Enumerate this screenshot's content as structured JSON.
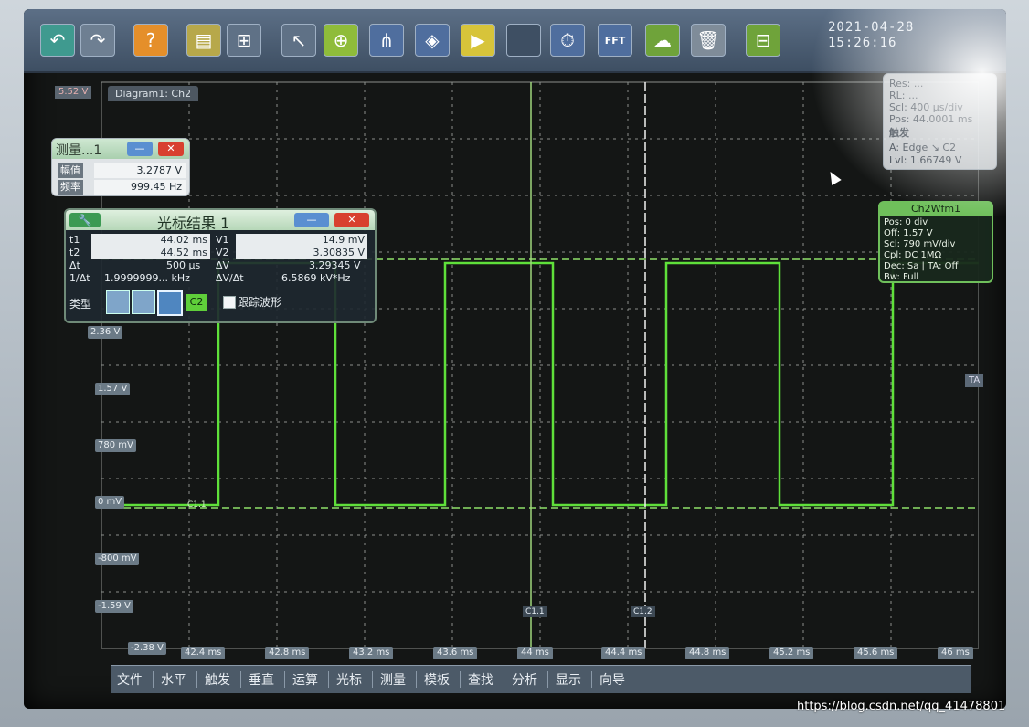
{
  "datetime": {
    "date": "2021-04-28",
    "time": "15:26:16"
  },
  "toolbar": {
    "buttons": [
      {
        "name": "undo-icon",
        "glyph": "↶",
        "bg": "#3f9a8f"
      },
      {
        "name": "redo-icon",
        "glyph": "↷",
        "bg": "#6e7f92"
      },
      {
        "name": "help-icon",
        "glyph": "?",
        "bg": "#e58f2a"
      },
      {
        "name": "folder-icon",
        "glyph": "▤",
        "bg": "#b7a84a"
      },
      {
        "name": "layout-icon",
        "glyph": "⊞",
        "bg": "#5f7186"
      },
      {
        "name": "pointer-icon",
        "glyph": "↖",
        "bg": "#5f7186"
      },
      {
        "name": "zoom-icon",
        "glyph": "⊕",
        "bg": "#8fbc3a"
      },
      {
        "name": "cursor-measure-icon",
        "glyph": "⋔",
        "bg": "#4f6e9e"
      },
      {
        "name": "mask-icon",
        "glyph": "◈",
        "bg": "#4f6e9e"
      },
      {
        "name": "marker-icon",
        "glyph": "▶",
        "bg": "#d7c43a"
      },
      {
        "name": "spacer-icon",
        "glyph": "",
        "bg": "#3e4f63"
      },
      {
        "name": "timer-icon",
        "glyph": "⏱",
        "bg": "#4f6e9e"
      },
      {
        "name": "fft-icon",
        "glyph": "FFT",
        "bg": "#4f6e9e"
      },
      {
        "name": "cloud-icon",
        "glyph": "☁",
        "bg": "#6fa33a"
      },
      {
        "name": "delete-icon",
        "glyph": "🗑",
        "bg": "#7f8c99"
      },
      {
        "name": "acquire-icon",
        "glyph": "⊟",
        "bg": "#6fa33a"
      }
    ]
  },
  "diagram_tab": "Diagram1: Ch2",
  "trigger_level_label": "5.52 V",
  "y_labels": [
    "2.36 V",
    "1.57 V",
    "780 mV",
    "0 mV",
    "-800 mV",
    "-1.59 V",
    "-2.38 V"
  ],
  "x_labels": [
    "42.4 ms",
    "42.8 ms",
    "43.2 ms",
    "43.6 ms",
    "44 ms",
    "44.4 ms",
    "44.8 ms",
    "45.2 ms",
    "45.6 ms",
    "46 ms"
  ],
  "measurement": {
    "title": "测量...1",
    "rows": [
      {
        "label": "幅值",
        "value": "3.2787 V"
      },
      {
        "label": "频率",
        "value": "999.45 Hz"
      }
    ]
  },
  "cursor_result": {
    "title": "光标结果 1",
    "t1_label": "t1",
    "t1": "44.02 ms",
    "t2_label": "t2",
    "t2": "44.52 ms",
    "v1_label": "V1",
    "v1": "14.9 mV",
    "v2_label": "V2",
    "v2": "3.30835 V",
    "dt_label": "Δt",
    "dt": "500 µs",
    "dv_label": "ΔV",
    "dv": "3.29345 V",
    "inv_dt_label": "1/Δt",
    "inv_dt": "1.9999999... kHz",
    "dvdt_label": "ΔV/Δt",
    "dvdt": "6.5869 kV*Hz",
    "type_label": "类型",
    "c2_label": "C2",
    "track_label": "跟踪波形"
  },
  "timebase": {
    "lines": [
      "Res: ...",
      "RL: ...",
      "Scl: 400 µs/div",
      "Pos: 44.0001 ms",
      "触发",
      "A:  Edge  ↘ C2",
      "Lvl: 1.66749 V"
    ]
  },
  "ch2_panel": {
    "title": "Ch2Wfm1",
    "lines": [
      "Pos: 0 div",
      "Off: 1.57 V",
      "Scl: 790 mV/div",
      "Cpl: DC 1MΩ",
      "Dec: Sa | TA: Off",
      "Bw: Full"
    ]
  },
  "markers": {
    "c11": "C1.1",
    "c12": "C1.2",
    "ta": "TA",
    "c11_left": "C1.1"
  },
  "menubar": [
    "文件",
    "水平",
    "触发",
    "垂直",
    "运算",
    "光标",
    "测量",
    "模板",
    "查找",
    "分析",
    "显示",
    "向导"
  ],
  "watermark": "https://blog.csdn.net/qq_41478801",
  "colors": {
    "trace": "#5fe03a",
    "grid": "#8b8f8c",
    "panel_green": "#6fbf5b"
  }
}
